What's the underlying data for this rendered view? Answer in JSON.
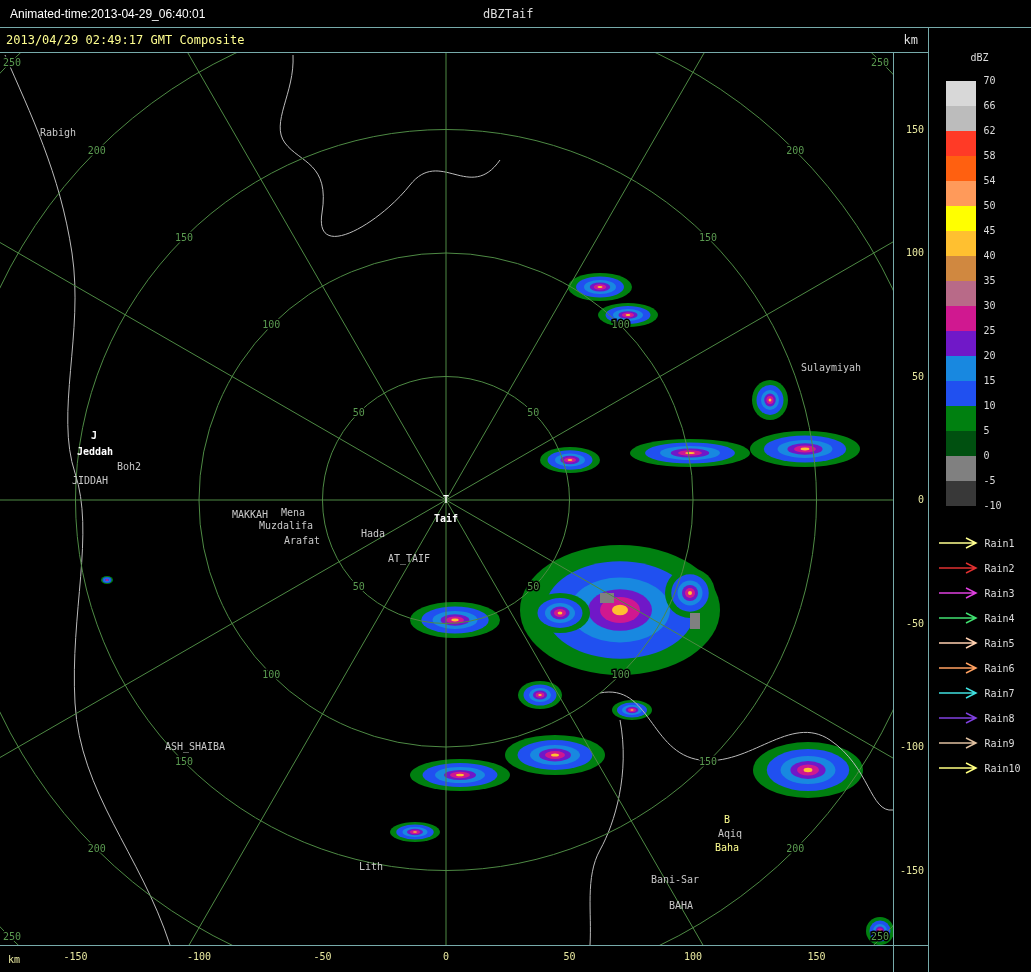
{
  "window": {
    "title": "Animated-time:2013-04-29_06:40:01",
    "product": "dBZTaif"
  },
  "map": {
    "header": "2013/04/29 02:49:17 GMT Composite",
    "unit": "km",
    "rings": [
      {
        "labels": [
          "50",
          "50",
          "50",
          "50"
        ]
      },
      {
        "labels": [
          "100",
          "100",
          "100",
          "100"
        ]
      },
      {
        "labels": [
          "150",
          "150",
          "150",
          "150"
        ]
      },
      {
        "labels": [
          "200",
          "200",
          "200",
          "200"
        ]
      },
      {
        "labels": [
          "250",
          "250",
          "250",
          "250"
        ]
      }
    ],
    "places": [
      {
        "name": "Rabigh",
        "kind": "secondary"
      },
      {
        "name": "J",
        "kind": "primary"
      },
      {
        "name": "Jeddah",
        "kind": "primary"
      },
      {
        "name": "Boh2",
        "kind": "secondary"
      },
      {
        "name": "JIDDAH",
        "kind": "secondary"
      },
      {
        "name": "MAKKAH",
        "kind": "secondary"
      },
      {
        "name": "Mena",
        "kind": "secondary"
      },
      {
        "name": "Muzdalifa",
        "kind": "secondary"
      },
      {
        "name": "Arafat",
        "kind": "secondary"
      },
      {
        "name": "Hada",
        "kind": "secondary"
      },
      {
        "name": "AT_TAIF",
        "kind": "secondary"
      },
      {
        "name": "T",
        "kind": "primary"
      },
      {
        "name": "Taif",
        "kind": "primary"
      },
      {
        "name": "Sulaymiyah",
        "kind": "secondary"
      },
      {
        "name": "B",
        "kind": "highlight"
      },
      {
        "name": "Aqiq",
        "kind": "secondary"
      },
      {
        "name": "Baha",
        "kind": "highlight"
      },
      {
        "name": "Bani-Sar",
        "kind": "secondary"
      },
      {
        "name": "BAHA",
        "kind": "secondary"
      },
      {
        "name": "Lith",
        "kind": "secondary"
      },
      {
        "name": "ASH_SHAIBA",
        "kind": "secondary"
      }
    ],
    "y_ticks": [
      "150",
      "100",
      "50",
      "0",
      "-50",
      "-100",
      "-150"
    ],
    "x_unit": "km",
    "x_ticks": [
      "-150",
      "-100",
      "-50",
      "0",
      "50",
      "100",
      "150"
    ]
  },
  "legend": {
    "title": "dBZ",
    "scale": [
      {
        "color": "#d8d8d8"
      },
      {
        "color": "#bcbcbc"
      },
      {
        "color": "#ff3a26"
      },
      {
        "color": "#ff6010"
      },
      {
        "color": "#ff9a5a"
      },
      {
        "color": "#ffff00"
      },
      {
        "color": "#ffc030"
      },
      {
        "color": "#d08840"
      },
      {
        "color": "#b86a88"
      },
      {
        "color": "#d01890"
      },
      {
        "color": "#7018c8"
      },
      {
        "color": "#1888e0"
      },
      {
        "color": "#2050f0"
      },
      {
        "color": "#008010"
      },
      {
        "color": "#005010"
      },
      {
        "color": "#808080"
      },
      {
        "color": "#383838"
      }
    ],
    "labels": [
      "70",
      "66",
      "62",
      "58",
      "54",
      "50",
      "45",
      "40",
      "35",
      "30",
      "25",
      "20",
      "15",
      "10",
      "5",
      "0",
      "-5",
      "-10"
    ],
    "tracks": [
      {
        "label": "Rain1",
        "color": "#ffff90"
      },
      {
        "label": "Rain2",
        "color": "#e03030"
      },
      {
        "label": "Rain3",
        "color": "#e040e0"
      },
      {
        "label": "Rain4",
        "color": "#40e070"
      },
      {
        "label": "Rain5",
        "color": "#ffd0b0"
      },
      {
        "label": "Rain6",
        "color": "#ffa060"
      },
      {
        "label": "Rain7",
        "color": "#40e0e0"
      },
      {
        "label": "Rain8",
        "color": "#8040e0"
      },
      {
        "label": "Rain9",
        "color": "#e0c0a0"
      },
      {
        "label": "Rain10",
        "color": "#ffff80"
      }
    ]
  }
}
